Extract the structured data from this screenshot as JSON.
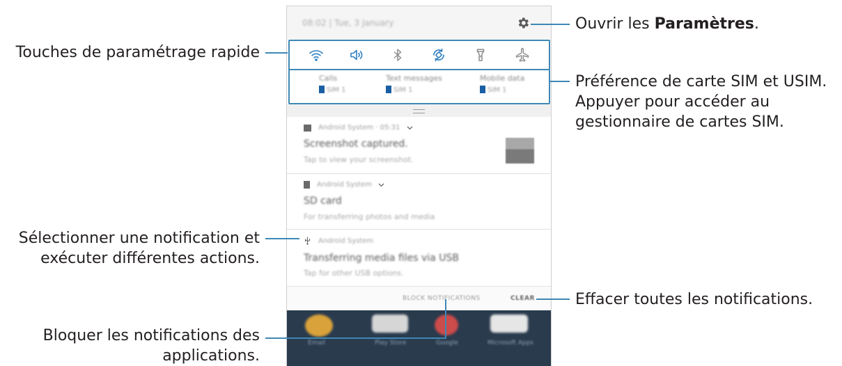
{
  "status_bar": {
    "time_date": "08:02 | Tue, 3 January"
  },
  "quick_settings": {
    "icons": [
      "wifi-icon",
      "sound-icon",
      "bluetooth-icon",
      "auto-rotate-icon",
      "flashlight-icon",
      "airplane-mode-icon"
    ]
  },
  "sim_preferences": {
    "columns": [
      {
        "title": "Calls",
        "sim": "SIM 1",
        "sim_number": "1"
      },
      {
        "title": "Text messages",
        "sim": "SIM 1",
        "sim_number": "1"
      },
      {
        "title": "Mobile data",
        "sim": "SIM 1",
        "sim_number": "1"
      }
    ]
  },
  "notifications": [
    {
      "icon": "image-icon",
      "app": "Android System · 05:31",
      "title": "Screenshot captured.",
      "subtitle": "Tap to view your screenshot."
    },
    {
      "icon": "sd-card-icon",
      "app": "Android System",
      "title": "SD card",
      "subtitle": "For transferring photos and media"
    },
    {
      "icon": "usb-icon",
      "app": "Android System",
      "title": "Transferring media files via USB",
      "subtitle": "Tap for other USB options."
    }
  ],
  "actions": {
    "block": "BLOCK NOTIFICATIONS",
    "clear": "CLEAR"
  },
  "home_apps": [
    {
      "label": "Email",
      "color": "#d9a23a"
    },
    {
      "label": "Play Store",
      "color": "#e0e0e0"
    },
    {
      "label": "Google",
      "color": "#cc4b4b"
    },
    {
      "label": "Microsoft Apps",
      "color": "#e6e6e6"
    }
  ],
  "callouts": {
    "settings_prefix": "Ouvrir les ",
    "settings_bold": "Paramètres",
    "settings_suffix": ".",
    "quick_settings": "Touches de paramétrage rapide",
    "sim_line1": "Préférence de carte SIM et USIM.",
    "sim_line2": "Appuyer pour accéder au",
    "sim_line3": "gestionnaire de cartes SIM.",
    "select_line1": "Sélectionner une notification et",
    "select_line2": "exécuter différentes actions.",
    "clear_all": "Effacer toutes les notifications.",
    "block_line1": "Bloquer les notifications des",
    "block_line2": "applications."
  },
  "colors": {
    "accent": "#3e88b5",
    "sim_badge": "#1a5fa3",
    "home_bg": "#2a3b4e",
    "text": "#231f20"
  }
}
